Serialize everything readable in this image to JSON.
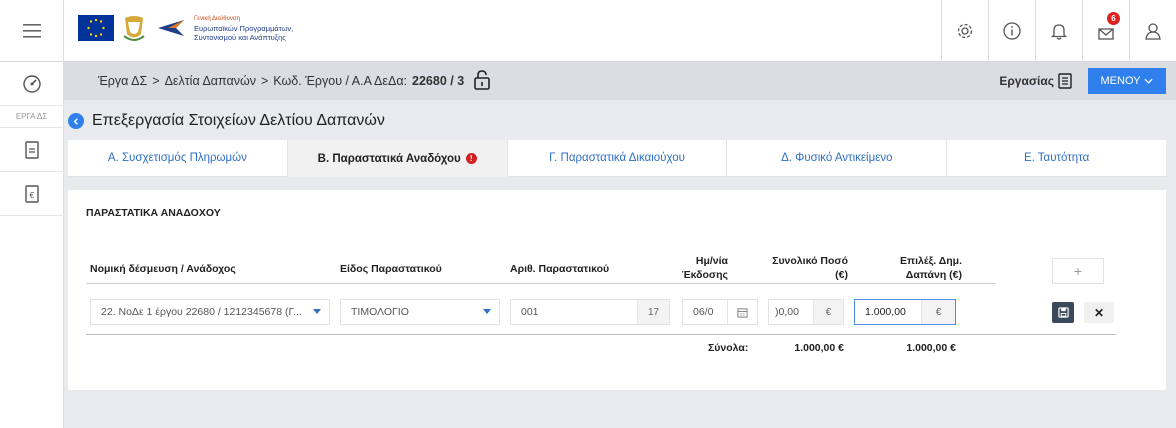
{
  "header": {
    "logo_lines": [
      "Γενική Διεύθυνση",
      "Ευρωπαϊκών Προγραμμάτων,",
      "Συντονισμού και Ανάπτυξης"
    ],
    "notification_count": "6",
    "icons": [
      "settings-icon",
      "info-icon",
      "bell-icon",
      "mail-icon",
      "user-icon"
    ]
  },
  "sidebar": {
    "label": "ΕΡΓΑ ΔΣ",
    "icons": [
      "dashboard-icon",
      "document-icon",
      "euro-document-icon"
    ]
  },
  "breadcrumb": {
    "item1": "Έργα ΔΣ",
    "sep": ">",
    "item2": "Δελτία Δαπανών",
    "item3": "Κωδ. Έργου / Α.Α ΔεΔα:",
    "code": "22680 / 3",
    "work_label": "Εργασίας",
    "menu_label": "ΜΕΝΟΥ"
  },
  "page": {
    "title": "Επεξεργασία Στοιχείων Δελτίου Δαπανών"
  },
  "tabs": [
    {
      "label": "Α. Συσχετισμός Πληρωμών"
    },
    {
      "label": "Β. Παραστατικά Αναδόχου"
    },
    {
      "label": "Γ. Παραστατικά Δικαιούχου"
    },
    {
      "label": "Δ. Φυσικό Αντικείμενο"
    },
    {
      "label": "Ε. Ταυτότητα"
    }
  ],
  "section": {
    "title": "ΠΑΡΑΣΤΑΤΙΚΑ ΑΝΑΔΟΧΟΥ",
    "headers": {
      "contractor": "Νομική δέσμευση / Ανάδοχος",
      "doc_type": "Είδος Παραστατικού",
      "doc_number": "Αριθ. Παραστατικού",
      "issue_date_1": "Ημ/νία",
      "issue_date_2": "Έκδοσης",
      "total_1": "Συνολικό Ποσό",
      "total_2": "(€)",
      "eligible_1": "Επιλέξ. Δημ.",
      "eligible_2": "Δαπάνη (€)"
    },
    "row": {
      "contractor": "22. ΝοΔε 1 έργου 22680 / 1212345678 (Γ...",
      "doc_type": "ΤΙΜΟΛΟΓΙΟ",
      "doc_number": "001",
      "doc_number_count": "17",
      "issue_date": "06/0",
      "total": ")0,00",
      "currency": "€",
      "eligible": "1.000,00"
    },
    "totals": {
      "label": "Σύνολα:",
      "total": "1.000,00 €",
      "eligible": "1.000,00 €"
    }
  },
  "colors": {
    "accent": "#2f80ed",
    "error": "#d32020"
  }
}
